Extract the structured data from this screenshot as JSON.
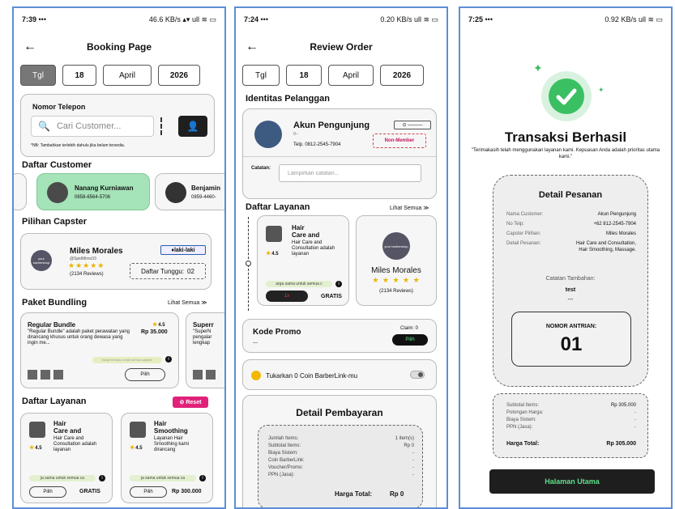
{
  "screen1": {
    "status": {
      "time": "7:39",
      "icons_left": "•••",
      "icons_right": "46.6 KB/s ▴▾ ull ≋ ▭"
    },
    "title": "Booking Page",
    "date": {
      "tgl": "Tgl",
      "day": "18",
      "month": "April",
      "year": "2026"
    },
    "phone_label": "Nomor Telepon",
    "search_placeholder": "Cari Customer...",
    "note": "*NB: Tambahkan terlebih dahulu jika belum tersedia.",
    "daftar_customer": "Daftar Customer",
    "customers": [
      {
        "name": "Nanang Kurniawan",
        "phone": "0858-6564-5706"
      },
      {
        "name": "Benjamin",
        "phone": "0859-4460-"
      }
    ],
    "pilihan_capster": "Pilihan Capster",
    "capster": {
      "name": "Miles Morales",
      "handle": "@SpidMimo33",
      "reviews": "(2134 Reviews)",
      "gender": "laki-laki",
      "queue_label": "Daftar Tunggu:",
      "queue_value": "02",
      "logo": "your barbershop"
    },
    "paket_bundling": "Paket Bundling",
    "lihat_semua": "Lihat Semua ≫",
    "bundles": [
      {
        "name": "Regular Bundle",
        "rating": "4.5",
        "price": "Rp 35.000",
        "desc": "\"Regular Bundle\" adalah paket perawatan yang dirancang khusus untuk orang dewasa yang ingin me...",
        "note": "harga berlaku untuk semua capster",
        "btn": "Pilih"
      },
      {
        "name": "Superr",
        "desc": "\"SuperN pengalar lengkap"
      }
    ],
    "daftar_layanan": "Daftar Layanan",
    "reset": "⊘ Reset",
    "services": [
      {
        "name1": "Hair",
        "name2": "Care and",
        "desc": "Hair Care and Consultation adalah layanan",
        "rating": "4.5",
        "note": "ja sama untuk semua ca",
        "btn": "Pilih",
        "price": "GRATIS"
      },
      {
        "name1": "Hair",
        "name2": "Smoothing",
        "desc": "Layanan Hair Smoothing kami dirancang",
        "rating": "4.5",
        "note": "ja sama untuk semua ca",
        "btn": "Pilih",
        "price": "Rp 300.000"
      }
    ]
  },
  "screen2": {
    "status": {
      "time": "7:24",
      "icons_left": "•••",
      "icons_right": "0.20 KB/s ull ≋ ▭"
    },
    "title": "Review Order",
    "date": {
      "tgl": "Tgl",
      "day": "18",
      "month": "April",
      "year": "2026"
    },
    "identitas": "Identitas Pelanggan",
    "customer": {
      "name": "Akun Pengunjung",
      "sub": "0--",
      "phone": "Telp. 0812-2545-7904",
      "badge": "Non-Member",
      "id_chip": "⊙ ———"
    },
    "catatan_label": "Catatan:",
    "catatan_placeholder": "Lampirkan catatan...",
    "daftar_layanan": "Daftar Layanan",
    "lihat_semua": "Lihat Semua ≫",
    "service": {
      "name1": "Hair",
      "name2": "Care and",
      "desc": "Hair Care and Consultation adalah layanan",
      "rating": "4.5",
      "note": "arga sama untuk semua c",
      "qty": "1x",
      "price": "GRATIS"
    },
    "capster": {
      "name": "Miles Morales",
      "reviews": "(2134 Reviews)",
      "logo": "your barbershop"
    },
    "kode_promo": "Kode Promo",
    "promo_value": "---",
    "claim": "Claim: 0",
    "pilih": "Pilih",
    "coin_text": "Tukarkan 0 Coin BarberLink-mu",
    "detail_pembayaran": "Detail Pembayaran",
    "rows": [
      {
        "label": "Jumlah Items:",
        "value": "1 item(s)"
      },
      {
        "label": "Subtotal Items:",
        "value": "Rp 0"
      },
      {
        "label": "Biaya Sistem:",
        "value": "-"
      },
      {
        "label": "Coin BarberLink:",
        "value": "-"
      },
      {
        "label": "Voucher/Promo:",
        "value": "-"
      },
      {
        "label": "PPN (Jasa):",
        "value": "-"
      }
    ],
    "harga_total_label": "Harga Total:",
    "harga_total_value": "Rp 0"
  },
  "screen3": {
    "status": {
      "time": "7:25",
      "icons_left": "•••",
      "icons_right": "0.92 KB/s ull ≋ ▭"
    },
    "title": "Transaksi Berhasil",
    "subtitle": "\"Terimakasih telah menggunakan layanan kami. Kepuasan Anda adalah prioritas utama kami.\"",
    "detail_title": "Detail Pesanan",
    "rows": [
      {
        "label": "Nama Customer:",
        "value": "Akun Pengunjung"
      },
      {
        "label": "No Telp:",
        "value": "+62 812-2545-7904"
      },
      {
        "label": "Capster Pilihan:",
        "value": "Miles Morales"
      },
      {
        "label": "Detail Pesanan:",
        "value": "Hair Care and Consultation, Hair Smoothing, Massage."
      }
    ],
    "catatan_label": "Catatan Tambahan:",
    "catatan_value": "test",
    "dash": "---",
    "antrian_label": "NOMOR ANTRIAN:",
    "antrian_value": "01",
    "totals": [
      {
        "label": "Subtotal Items:",
        "value": "Rp 305.000"
      },
      {
        "label": "Potongan Harga:",
        "value": "-"
      },
      {
        "label": "Biaya Sistem:",
        "value": "-"
      },
      {
        "label": "PPN (Jasa):",
        "value": "-"
      }
    ],
    "harga_total_label": "Harga Total:",
    "harga_total_value": "Rp 305.000",
    "home_btn": "Halaman Utama"
  },
  "colors": {
    "accent_green": "#a5e3b8",
    "dark": "#222222",
    "reset_pink": "#e0217a",
    "success_green": "#3bbf63",
    "phone_border": "#5b8fd6"
  }
}
